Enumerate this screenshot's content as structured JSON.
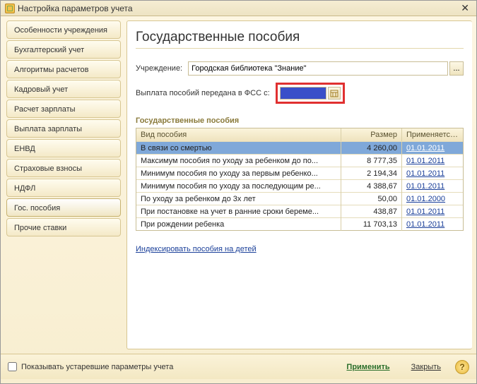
{
  "window": {
    "title": "Настройка параметров учета"
  },
  "sidebar": {
    "items": [
      {
        "label": "Особенности учреждения"
      },
      {
        "label": "Бухгалтерский учет"
      },
      {
        "label": "Алгоритмы расчетов"
      },
      {
        "label": "Кадровый учет"
      },
      {
        "label": "Расчет зарплаты"
      },
      {
        "label": "Выплата зарплаты"
      },
      {
        "label": "ЕНВД"
      },
      {
        "label": "Страховые взносы"
      },
      {
        "label": "НДФЛ"
      },
      {
        "label": "Гос. пособия"
      },
      {
        "label": "Прочие ставки"
      }
    ],
    "active_index": 9
  },
  "main": {
    "heading": "Государственные пособия",
    "institution_label": "Учреждение:",
    "institution_value": "Городская библиотека \"Знание\"",
    "fss_label": "Выплата пособий передана в ФСС с:",
    "fss_date": "",
    "section_title": "Государственные пособия",
    "columns": {
      "name": "Вид пособия",
      "size": "Размер",
      "date": "Применяется с"
    },
    "rows": [
      {
        "name": "В связи со смертью",
        "size": "4 260,00",
        "date": "01.01.2011"
      },
      {
        "name": "Максимум пособия по уходу за ребенком до по...",
        "size": "8 777,35",
        "date": "01.01.2011"
      },
      {
        "name": "Минимум пособия по уходу за первым ребенко...",
        "size": "2 194,34",
        "date": "01.01.2011"
      },
      {
        "name": "Минимум пособия по уходу за последующим ре...",
        "size": "4 388,67",
        "date": "01.01.2011"
      },
      {
        "name": "По уходу за ребенком до 3х лет",
        "size": "50,00",
        "date": "01.01.2000"
      },
      {
        "name": "При постановке на учет в ранние сроки береме...",
        "size": "438,87",
        "date": "01.01.2011"
      },
      {
        "name": "При рождении ребенка",
        "size": "11 703,13",
        "date": "01.01.2011"
      }
    ],
    "selected_row": 0,
    "index_link": "Индексировать пособия на детей"
  },
  "footer": {
    "checkbox_label": "Показывать устаревшие параметры учета",
    "apply": "Применить",
    "close": "Закрыть",
    "help": "?"
  }
}
